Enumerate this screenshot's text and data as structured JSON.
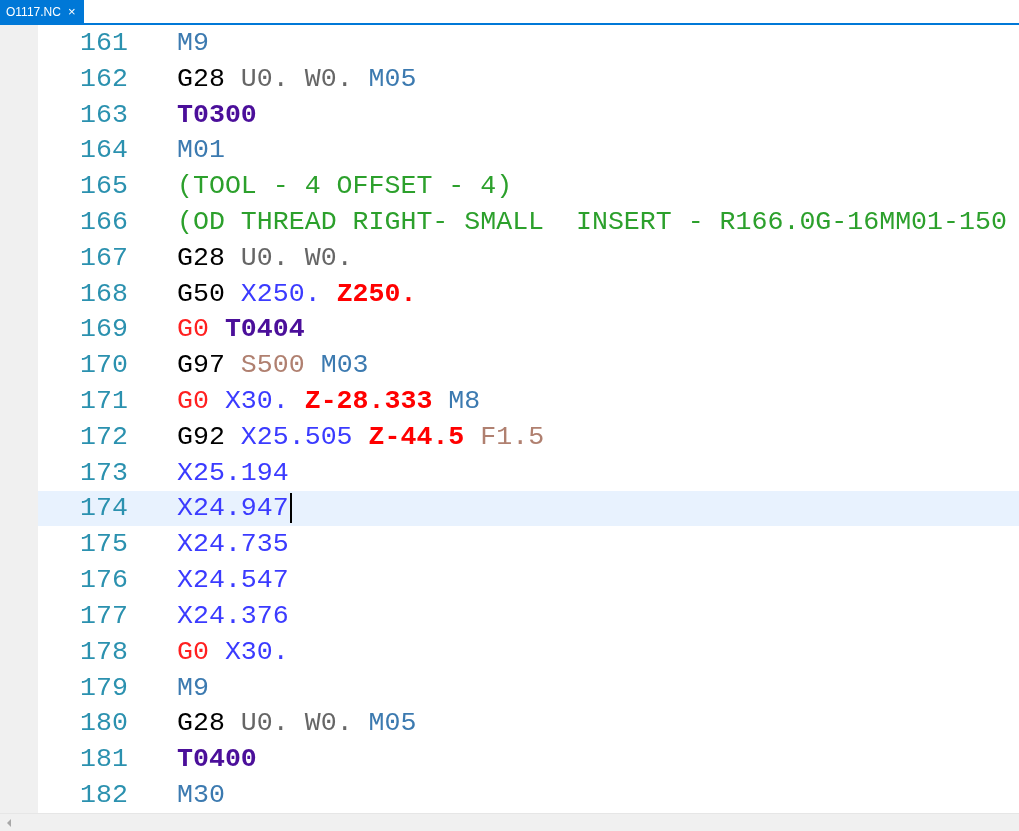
{
  "tabs": [
    {
      "label": "O1117.NC",
      "close": "×",
      "selected": true
    }
  ],
  "lines": [
    {
      "number": "161",
      "current": false,
      "tokens": [
        {
          "kind": "mcode",
          "text": "M9"
        }
      ]
    },
    {
      "number": "162",
      "current": false,
      "tokens": [
        {
          "kind": "gcode",
          "text": "G28"
        },
        {
          "kind": "axis",
          "text": "U0."
        },
        {
          "kind": "axis",
          "text": "W0."
        },
        {
          "kind": "mcode",
          "text": "M05"
        }
      ]
    },
    {
      "number": "163",
      "current": false,
      "tokens": [
        {
          "kind": "tool",
          "text": "T0300"
        }
      ]
    },
    {
      "number": "164",
      "current": false,
      "tokens": [
        {
          "kind": "mcode",
          "text": "M01"
        }
      ]
    },
    {
      "number": "165",
      "current": false,
      "tokens": [
        {
          "kind": "comment",
          "text": "(TOOL - 4 OFFSET - 4)"
        }
      ]
    },
    {
      "number": "166",
      "current": false,
      "tokens": [
        {
          "kind": "comment",
          "text": "(OD THREAD RIGHT- SMALL  INSERT - R166.0G-16MM01-150"
        }
      ]
    },
    {
      "number": "167",
      "current": false,
      "tokens": [
        {
          "kind": "gcode",
          "text": "G28"
        },
        {
          "kind": "axis",
          "text": "U0."
        },
        {
          "kind": "axis",
          "text": "W0."
        }
      ]
    },
    {
      "number": "168",
      "current": false,
      "tokens": [
        {
          "kind": "gcode",
          "text": "G50"
        },
        {
          "kind": "x",
          "text": "X250."
        },
        {
          "kind": "z",
          "text": "Z250."
        }
      ]
    },
    {
      "number": "169",
      "current": false,
      "tokens": [
        {
          "kind": "rapid",
          "text": "G0"
        },
        {
          "kind": "tool",
          "text": "T0404"
        }
      ]
    },
    {
      "number": "170",
      "current": false,
      "tokens": [
        {
          "kind": "gcode",
          "text": "G97"
        },
        {
          "kind": "feed",
          "text": "S500"
        },
        {
          "kind": "mcode",
          "text": "M03"
        }
      ]
    },
    {
      "number": "171",
      "current": false,
      "tokens": [
        {
          "kind": "rapid",
          "text": "G0"
        },
        {
          "kind": "x",
          "text": "X30."
        },
        {
          "kind": "z",
          "text": "Z-28.333"
        },
        {
          "kind": "mcode",
          "text": "M8"
        }
      ]
    },
    {
      "number": "172",
      "current": false,
      "tokens": [
        {
          "kind": "gcode",
          "text": "G92"
        },
        {
          "kind": "x",
          "text": "X25.505"
        },
        {
          "kind": "z",
          "text": "Z-44.5"
        },
        {
          "kind": "feed",
          "text": "F1.5"
        }
      ]
    },
    {
      "number": "173",
      "current": false,
      "tokens": [
        {
          "kind": "x",
          "text": "X25.194"
        }
      ]
    },
    {
      "number": "174",
      "current": true,
      "tokens": [
        {
          "kind": "x",
          "text": "X24.947"
        }
      ]
    },
    {
      "number": "175",
      "current": false,
      "tokens": [
        {
          "kind": "x",
          "text": "X24.735"
        }
      ]
    },
    {
      "number": "176",
      "current": false,
      "tokens": [
        {
          "kind": "x",
          "text": "X24.547"
        }
      ]
    },
    {
      "number": "177",
      "current": false,
      "tokens": [
        {
          "kind": "x",
          "text": "X24.376"
        }
      ]
    },
    {
      "number": "178",
      "current": false,
      "tokens": [
        {
          "kind": "rapid",
          "text": "G0"
        },
        {
          "kind": "x",
          "text": "X30."
        }
      ]
    },
    {
      "number": "179",
      "current": false,
      "tokens": [
        {
          "kind": "mcode",
          "text": "M9"
        }
      ]
    },
    {
      "number": "180",
      "current": false,
      "tokens": [
        {
          "kind": "gcode",
          "text": "G28"
        },
        {
          "kind": "axis",
          "text": "U0."
        },
        {
          "kind": "axis",
          "text": "W0."
        },
        {
          "kind": "mcode",
          "text": "M05"
        }
      ]
    },
    {
      "number": "181",
      "current": false,
      "tokens": [
        {
          "kind": "tool",
          "text": "T0400"
        }
      ]
    },
    {
      "number": "182",
      "current": false,
      "tokens": [
        {
          "kind": "mcode",
          "text": "M30"
        }
      ]
    }
  ]
}
